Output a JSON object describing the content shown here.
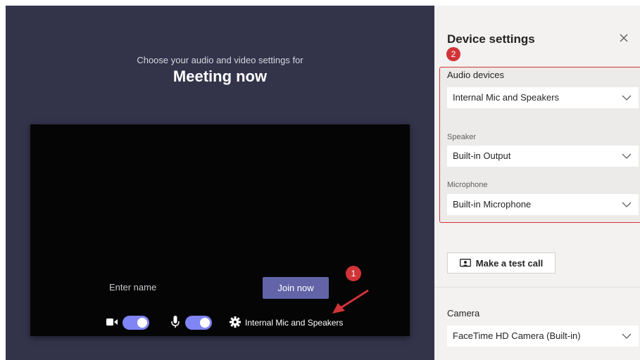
{
  "prejoin": {
    "subtitle": "Choose your audio and video settings for",
    "title": "Meeting now",
    "name_placeholder": "Enter name",
    "join_label": "Join now",
    "audio_device": "Internal Mic and Speakers",
    "camera_on": true,
    "mic_on": true
  },
  "annotations": {
    "badge_1": "1",
    "badge_2": "2",
    "highlight_color": "#d13438"
  },
  "device_settings": {
    "title": "Device settings",
    "audio_section": "Audio devices",
    "audio_selected": "Internal Mic and Speakers",
    "speaker_label": "Speaker",
    "speaker_selected": "Built-in Output",
    "microphone_label": "Microphone",
    "microphone_selected": "Built-in Microphone",
    "test_call_label": "Make a test call",
    "camera_section": "Camera",
    "camera_selected": "FaceTime HD Camera (Built-in)"
  },
  "colors": {
    "accent": "#6264a7",
    "toggle": "#7f85f5",
    "prejoin_bg": "#33344a",
    "panel_bg": "#f3f2f1"
  }
}
